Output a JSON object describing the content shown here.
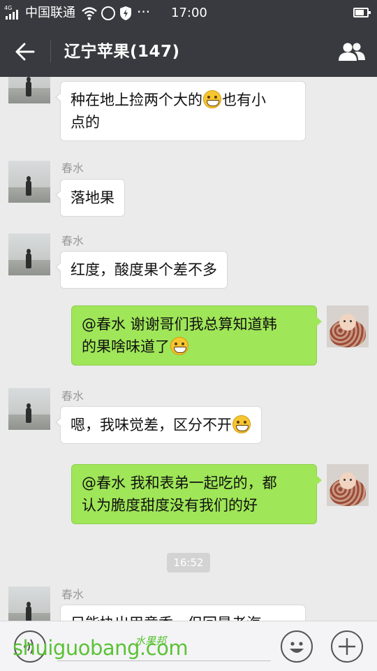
{
  "status_bar": {
    "network_type": "4G",
    "carrier": "中国联通",
    "more_indicator": "···",
    "time": "17:00",
    "icons": [
      "signal-icon",
      "wifi-icon",
      "vpn-icon",
      "shield-icon",
      "battery-icon"
    ]
  },
  "header": {
    "title": "辽宁苹果(147)",
    "back_icon": "back-arrow-icon",
    "members_icon": "group-members-icon",
    "background": "#393a3f"
  },
  "messages": [
    {
      "direction": "in",
      "sender": "",
      "segments": [
        "种在地上捡两个大的",
        "也有小",
        "点的"
      ]
    },
    {
      "direction": "in",
      "sender": "春水",
      "text": "落地果"
    },
    {
      "direction": "in",
      "sender": "春水",
      "text": "红度，酸度果个差不多"
    },
    {
      "direction": "out",
      "segments": [
        "@春水 谢谢哥们我总算知道韩",
        "的果啥味道了"
      ]
    },
    {
      "direction": "in",
      "sender": "春水",
      "segments": [
        "嗯，我味觉差，区分不开"
      ]
    },
    {
      "direction": "out",
      "segments": [
        "@春水 我和表弟一起吃的，都",
        "认为脆度甜度没有我们的好"
      ]
    },
    {
      "direction": "in",
      "sender": "春水",
      "text": "只能协出甲意香，但回是老汽"
    }
  ],
  "timestamp": "16:52",
  "colors": {
    "chat_background": "#ebebeb",
    "outgoing_bubble": "#9fe658",
    "incoming_bubble": "#ffffff",
    "watermark": "#5bc236"
  },
  "input_bar": {
    "voice_icon": "voice-input-icon",
    "emoji_icon": "emoji-icon",
    "more_icon": "plus-icon"
  },
  "watermark": {
    "text": "shuiguobang.com",
    "cn_text": "水果邦"
  }
}
